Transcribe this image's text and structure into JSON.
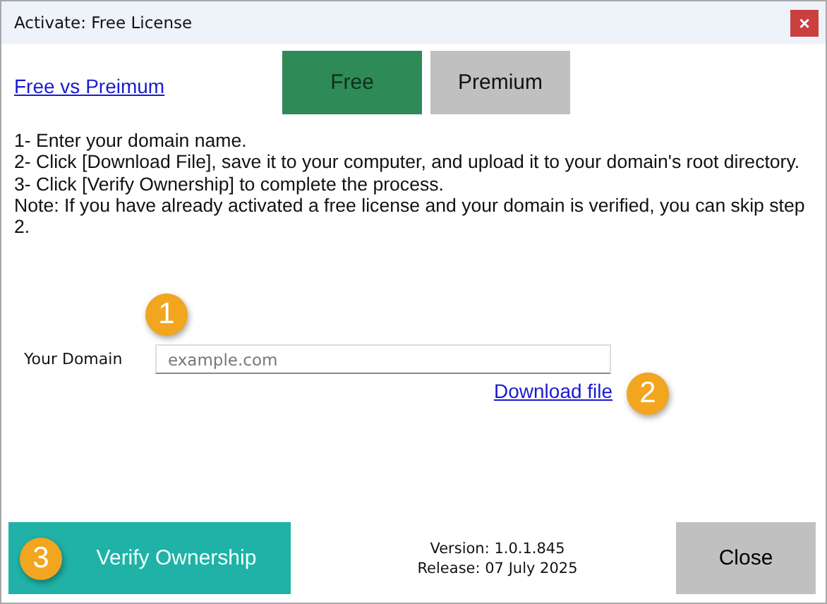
{
  "window": {
    "title": "Activate: Free License",
    "close": "×"
  },
  "compare_link": "Free vs Preimum",
  "tabs": [
    {
      "label": "Free",
      "selected": true
    },
    {
      "label": "Premium",
      "selected": false
    }
  ],
  "instructions": [
    "1- Enter your domain name.",
    "2- Click [Download File], save it to your computer, and upload it to your domain's root directory.",
    "3- Click [Verify Ownership] to complete the process.",
    "Note: If you have already activated a free license and your domain is verified, you can skip step 2."
  ],
  "domain": {
    "label": "Your Domain",
    "placeholder": "example.com"
  },
  "download_link": "Download file",
  "badges": [
    "1",
    "2",
    "3"
  ],
  "verify_button": "Verify Ownership",
  "version": "Version: 1.0.1.845",
  "release": "Release: 07 July 2025",
  "close_button": "Close"
}
